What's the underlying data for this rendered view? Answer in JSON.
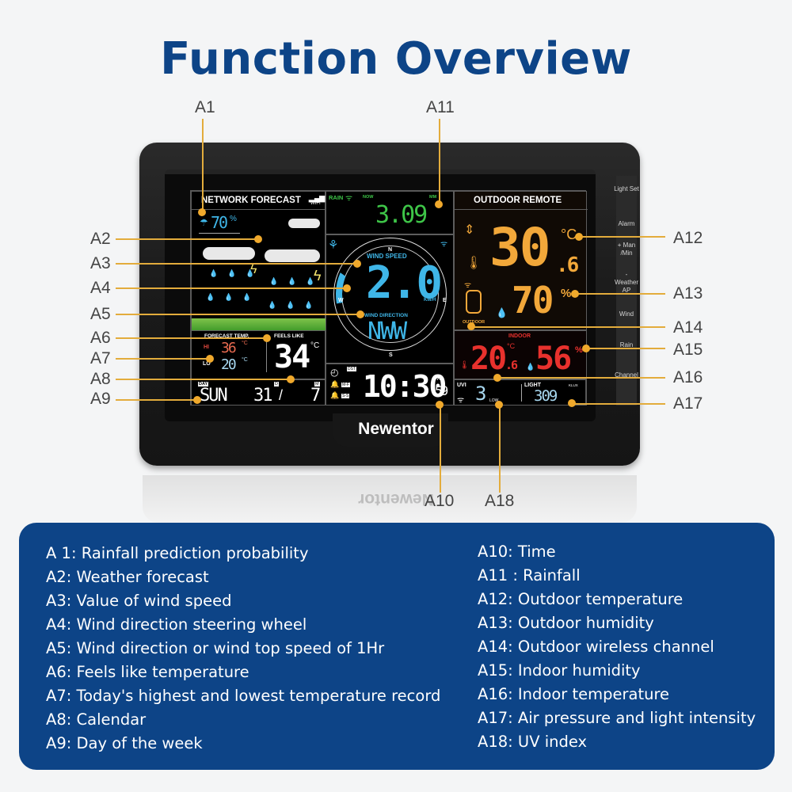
{
  "title": "Function Overview",
  "brand": "Newentor",
  "side_buttons": [
    "Light Set",
    "Alarm",
    "+ Man /Min",
    "- Weather AP",
    "Wind",
    "Rain",
    "Channel"
  ],
  "callouts": {
    "a1": "A1",
    "a2": "A2",
    "a3": "A3",
    "a4": "A4",
    "a5": "A5",
    "a6": "A6",
    "a7": "A7",
    "a8": "A8",
    "a9": "A9",
    "a10": "A10",
    "a11": "A11",
    "a12": "A12",
    "a13": "A13",
    "a14": "A14",
    "a15": "A15",
    "a16": "A16",
    "a17": "A17",
    "a18": "A18"
  },
  "lcd": {
    "forecast": {
      "header": "NETWORK FORECAST",
      "wifi_label": "WIFI",
      "rain_probability": "70",
      "percent": "%"
    },
    "temps": {
      "forecast_label": "FORECAST TEMP.",
      "feels_label": "FEELS LIKE",
      "hi_label": "HI",
      "hi_value": "36",
      "lo_label": "LO",
      "lo_value": "20",
      "feels_value": "34",
      "unit": "°C"
    },
    "date": {
      "day_label": "DAY",
      "day": "SUN",
      "date": "31",
      "month": "7",
      "d_label": "D",
      "m_label": "M"
    },
    "rain": {
      "label": "RAIN",
      "now_label": "NOW",
      "unit": "MM",
      "value": "3.09"
    },
    "wind": {
      "speed_label": "WIND SPEED",
      "speed": "2.0",
      "unit": "KM/H",
      "direction_label": "WIND DIRECTION",
      "direction": "NWW",
      "n": "N",
      "s": "S",
      "e": "E",
      "w": "W"
    },
    "clock": {
      "dst_label": "DST",
      "alarm1_label": "M-F",
      "alarm2_label": "S-S",
      "time": "10:30",
      "seconds": "59",
      "pct": "%"
    },
    "outdoor": {
      "header": "OUTDOOR REMOTE",
      "temp": "30",
      "temp_decimal": ".6",
      "unit": "°C",
      "humidity": "70",
      "pct": "%",
      "channel_label": "OUTDOOR"
    },
    "indoor": {
      "label": "INDOOR",
      "temp": "20",
      "temp_decimal": ".6",
      "unit": "°C",
      "humidity": "56",
      "pct": "%"
    },
    "uvi": {
      "label": "UVI",
      "value": "3",
      "level": "LOW"
    },
    "light": {
      "label": "LIGHT",
      "unit": "KLUX",
      "value": "309"
    }
  },
  "legend_left": [
    "A 1: Rainfall prediction probability",
    "A2: Weather forecast",
    "A3: Value of wind speed",
    "A4: Wind direction steering wheel",
    "A5: Wind direction or wind top speed of 1Hr",
    "A6: Feels like temperature",
    "A7: Today's highest and lowest temperature record",
    "A8: Calendar",
    "A9: Day of the week"
  ],
  "legend_right": [
    "A10: Time",
    "A11 : Rainfall",
    "A12: Outdoor temperature",
    "A13: Outdoor humidity",
    "A14: Outdoor wireless channel",
    "A15: Indoor humidity",
    "A16: Indoor temperature",
    "A17: Air pressure and light intensity",
    "A18: UV index"
  ],
  "colors": {
    "title": "#0d4487",
    "callout_line": "#e3ac3c",
    "lcd_blue": "#3fb6e8",
    "lcd_green": "#3ec548",
    "lcd_orange": "#f2a83a",
    "lcd_red": "#e8312d",
    "lcd_ice": "#a8d8f0"
  }
}
